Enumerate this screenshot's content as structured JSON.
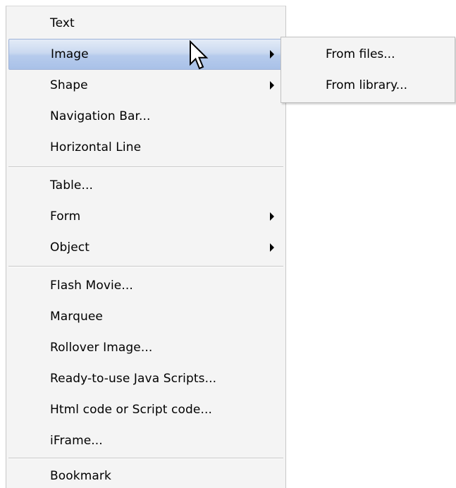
{
  "menu": {
    "items": [
      {
        "label": "Text",
        "has_submenu": false
      },
      {
        "label": "Image",
        "has_submenu": true,
        "active": true
      },
      {
        "label": "Shape",
        "has_submenu": true
      },
      {
        "label": "Navigation Bar...",
        "has_submenu": false
      },
      {
        "label": "Horizontal Line",
        "has_submenu": false
      },
      {
        "label": "Table...",
        "has_submenu": false
      },
      {
        "label": "Form",
        "has_submenu": true
      },
      {
        "label": "Object",
        "has_submenu": true
      },
      {
        "label": "Flash Movie...",
        "has_submenu": false
      },
      {
        "label": "Marquee",
        "has_submenu": false
      },
      {
        "label": "Rollover Image...",
        "has_submenu": false
      },
      {
        "label": "Ready-to-use Java Scripts...",
        "has_submenu": false
      },
      {
        "label": "Html code or Script code...",
        "has_submenu": false
      },
      {
        "label": "iFrame...",
        "has_submenu": false
      },
      {
        "label": "Bookmark",
        "has_submenu": false
      }
    ]
  },
  "submenu": {
    "parent": "Image",
    "items": [
      {
        "label": "From files..."
      },
      {
        "label": "From library..."
      }
    ]
  },
  "colors": {
    "menu_background": "#f4f4f4",
    "highlight": "#b6cbec",
    "separator": "#c8c8c8"
  },
  "icons": {
    "submenu_arrow": "triangle-right",
    "cursor": "arrow-pointer"
  }
}
